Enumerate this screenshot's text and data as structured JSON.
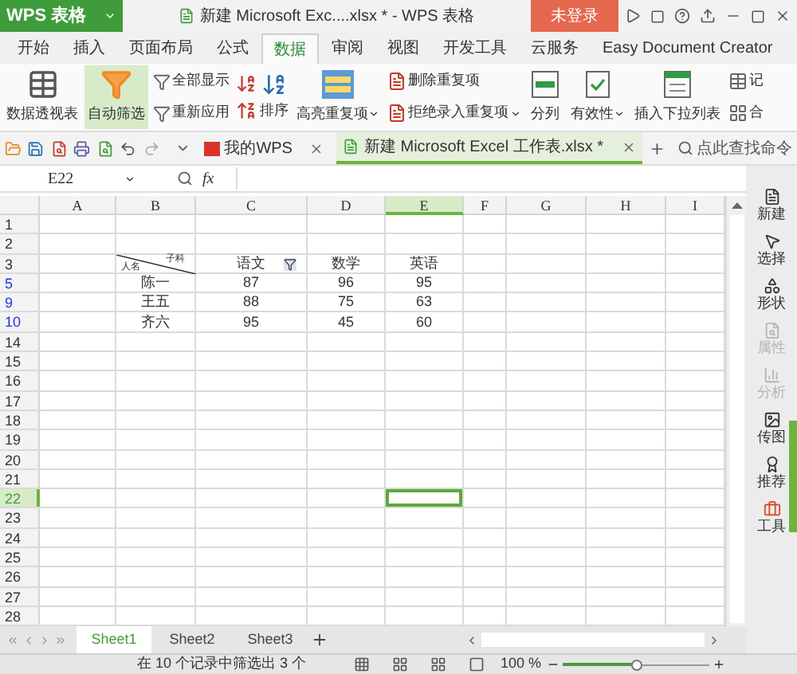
{
  "title_bar": {
    "app_button": "WPS 表格",
    "document_title": "新建 Microsoft Exc....xlsx * - WPS 表格",
    "login_button": "未登录"
  },
  "menu_tabs": [
    {
      "label": "开始",
      "selected": false
    },
    {
      "label": "插入",
      "selected": false
    },
    {
      "label": "页面布局",
      "selected": false
    },
    {
      "label": "公式",
      "selected": false
    },
    {
      "label": "数据",
      "selected": true
    },
    {
      "label": "审阅",
      "selected": false
    },
    {
      "label": "视图",
      "selected": false
    },
    {
      "label": "开发工具",
      "selected": false
    },
    {
      "label": "云服务",
      "selected": false
    },
    {
      "label": "Easy Document Creator",
      "selected": false
    }
  ],
  "ribbon": [
    {
      "kind": "large",
      "label": "数据透视表",
      "active": false
    },
    {
      "kind": "large",
      "label": "自动筛选",
      "active": true
    },
    {
      "kind": "stack",
      "items": [
        {
          "label": "全部显示",
          "dropdown": false
        },
        {
          "label": "重新应用",
          "dropdown": false
        }
      ]
    },
    {
      "kind": "sort",
      "label": "排序"
    },
    {
      "kind": "large",
      "label": "高亮重复项",
      "active": false,
      "dropdown": true
    },
    {
      "kind": "stack",
      "items": [
        {
          "label": "删除重复项",
          "dropdown": false
        },
        {
          "label": "拒绝录入重复项",
          "dropdown": true
        }
      ]
    },
    {
      "kind": "large",
      "label": "分列",
      "active": false,
      "dropdown": false
    },
    {
      "kind": "large",
      "label": "有效性",
      "active": false,
      "dropdown": true
    },
    {
      "kind": "large",
      "label": "插入下拉列表",
      "active": false,
      "dropdown": false
    },
    {
      "kind": "stack",
      "items": [
        {
          "label": "记",
          "dropdown": false
        },
        {
          "label": "合",
          "dropdown": false
        }
      ]
    }
  ],
  "doc_tabs": [
    {
      "label": "我的WPS",
      "selected": false
    },
    {
      "label": "新建 Microsoft Excel 工作表.xlsx *",
      "selected": true
    }
  ],
  "command_search": {
    "placeholder": "点此查找命令"
  },
  "formula_bar": {
    "cell_ref": "E22",
    "fx": "fx"
  },
  "columns": [
    {
      "label": "A",
      "selected": false
    },
    {
      "label": "B",
      "selected": false
    },
    {
      "label": "C",
      "selected": false
    },
    {
      "label": "D",
      "selected": false
    },
    {
      "label": "E",
      "selected": true
    },
    {
      "label": "F",
      "selected": false
    },
    {
      "label": "G",
      "selected": false
    },
    {
      "label": "H",
      "selected": false
    },
    {
      "label": "I",
      "selected": false
    }
  ],
  "rows": [
    {
      "number": "1",
      "filtered": false,
      "selected": false
    },
    {
      "number": "2",
      "filtered": false,
      "selected": false
    },
    {
      "number": "3",
      "filtered": false,
      "selected": false,
      "kind": "header",
      "diagonal_top": "子科",
      "diagonal_bottom": "人名",
      "cells": [
        "语文",
        "数学",
        "英语"
      ]
    },
    {
      "number": "5",
      "filtered": true,
      "selected": false,
      "cells": [
        "陈一",
        "87",
        "96",
        "95"
      ]
    },
    {
      "number": "9",
      "filtered": true,
      "selected": false,
      "cells": [
        "王五",
        "88",
        "75",
        "63"
      ]
    },
    {
      "number": "10",
      "filtered": true,
      "selected": false,
      "cells": [
        "齐六",
        "95",
        "45",
        "60"
      ]
    },
    {
      "number": "14",
      "filtered": false,
      "selected": false
    },
    {
      "number": "15",
      "filtered": false,
      "selected": false
    },
    {
      "number": "16",
      "filtered": false,
      "selected": false
    },
    {
      "number": "17",
      "filtered": false,
      "selected": false
    },
    {
      "number": "18",
      "filtered": false,
      "selected": false
    },
    {
      "number": "19",
      "filtered": false,
      "selected": false
    },
    {
      "number": "20",
      "filtered": false,
      "selected": false
    },
    {
      "number": "21",
      "filtered": false,
      "selected": false
    },
    {
      "number": "22",
      "filtered": false,
      "selected": true
    },
    {
      "number": "23",
      "filtered": false,
      "selected": false
    },
    {
      "number": "24",
      "filtered": false,
      "selected": false
    },
    {
      "number": "25",
      "filtered": false,
      "selected": false
    },
    {
      "number": "26",
      "filtered": false,
      "selected": false
    },
    {
      "number": "27",
      "filtered": false,
      "selected": false
    },
    {
      "number": "28",
      "filtered": false,
      "selected": false
    }
  ],
  "side_panel": [
    {
      "label": "新建",
      "disabled": false
    },
    {
      "label": "选择",
      "disabled": false
    },
    {
      "label": "形状",
      "disabled": false
    },
    {
      "label": "属性",
      "disabled": true
    },
    {
      "label": "分析",
      "disabled": true
    },
    {
      "label": "传图",
      "disabled": false
    },
    {
      "label": "推荐",
      "disabled": false
    },
    {
      "label": "工具",
      "disabled": false
    }
  ],
  "sheet_tabs": [
    {
      "label": "Sheet1",
      "selected": true
    },
    {
      "label": "Sheet2",
      "selected": false
    },
    {
      "label": "Sheet3",
      "selected": false
    }
  ],
  "status_bar": {
    "message": "在 10 个记录中筛选出 3 个",
    "zoom_text": "100 %",
    "zoom": {
      "level": 0.5
    }
  }
}
